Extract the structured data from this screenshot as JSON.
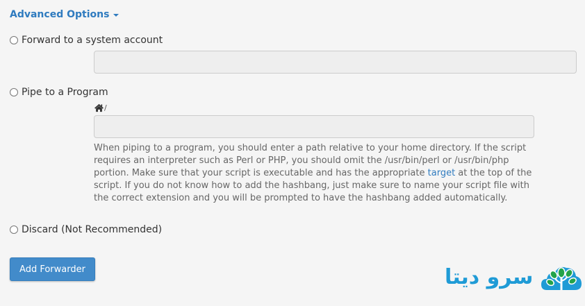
{
  "advanced_options": {
    "label": "Advanced Options",
    "expanded": true
  },
  "options": {
    "forward_system": {
      "label": "Forward to a system account",
      "selected": false,
      "field_value": ""
    },
    "pipe_program": {
      "label": "Pipe to a Program",
      "selected": false,
      "path_prefix": "/",
      "field_value": ""
    },
    "discard": {
      "label": "Discard (Not Recommended)",
      "selected": false
    }
  },
  "help": {
    "text_before": "When piping to a program, you should enter a path relative to your home directory. If the script requires an interpreter such as Perl or PHP, you should omit the /usr/bin/perl or /usr/bin/php portion. Make sure that your script is executable and has the appropriate ",
    "link_text": "target",
    "text_after": " at the top of the script. If you do not know how to add the hashbang, just make sure to name your script file with the correct extension and you will be prompted to have the hashbang added automatically."
  },
  "buttons": {
    "add_forwarder": "Add Forwarder"
  },
  "logo": {
    "text": "سرو دیتا"
  },
  "colors": {
    "link": "#2f7bbf",
    "primary_button": "#428bca",
    "logo_blue": "#1f9bd6",
    "logo_green": "#22a34a",
    "field_bg": "#eeeeee",
    "page_bg": "#f5f5f5"
  },
  "icons": {
    "caret": "caret-down-icon",
    "home": "home-icon",
    "logo": "cloud-tree-logo-icon"
  }
}
